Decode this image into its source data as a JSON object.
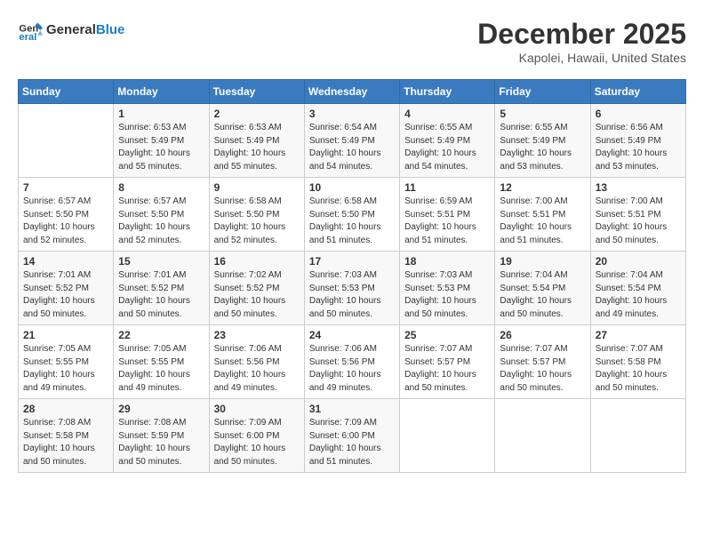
{
  "logo": {
    "line1": "General",
    "line2": "Blue"
  },
  "title": "December 2025",
  "subtitle": "Kapolei, Hawaii, United States",
  "days_header": [
    "Sunday",
    "Monday",
    "Tuesday",
    "Wednesday",
    "Thursday",
    "Friday",
    "Saturday"
  ],
  "weeks": [
    [
      {
        "day": "",
        "info": ""
      },
      {
        "day": "1",
        "info": "Sunrise: 6:53 AM\nSunset: 5:49 PM\nDaylight: 10 hours\nand 55 minutes."
      },
      {
        "day": "2",
        "info": "Sunrise: 6:53 AM\nSunset: 5:49 PM\nDaylight: 10 hours\nand 55 minutes."
      },
      {
        "day": "3",
        "info": "Sunrise: 6:54 AM\nSunset: 5:49 PM\nDaylight: 10 hours\nand 54 minutes."
      },
      {
        "day": "4",
        "info": "Sunrise: 6:55 AM\nSunset: 5:49 PM\nDaylight: 10 hours\nand 54 minutes."
      },
      {
        "day": "5",
        "info": "Sunrise: 6:55 AM\nSunset: 5:49 PM\nDaylight: 10 hours\nand 53 minutes."
      },
      {
        "day": "6",
        "info": "Sunrise: 6:56 AM\nSunset: 5:49 PM\nDaylight: 10 hours\nand 53 minutes."
      }
    ],
    [
      {
        "day": "7",
        "info": "Sunrise: 6:57 AM\nSunset: 5:50 PM\nDaylight: 10 hours\nand 52 minutes."
      },
      {
        "day": "8",
        "info": "Sunrise: 6:57 AM\nSunset: 5:50 PM\nDaylight: 10 hours\nand 52 minutes."
      },
      {
        "day": "9",
        "info": "Sunrise: 6:58 AM\nSunset: 5:50 PM\nDaylight: 10 hours\nand 52 minutes."
      },
      {
        "day": "10",
        "info": "Sunrise: 6:58 AM\nSunset: 5:50 PM\nDaylight: 10 hours\nand 51 minutes."
      },
      {
        "day": "11",
        "info": "Sunrise: 6:59 AM\nSunset: 5:51 PM\nDaylight: 10 hours\nand 51 minutes."
      },
      {
        "day": "12",
        "info": "Sunrise: 7:00 AM\nSunset: 5:51 PM\nDaylight: 10 hours\nand 51 minutes."
      },
      {
        "day": "13",
        "info": "Sunrise: 7:00 AM\nSunset: 5:51 PM\nDaylight: 10 hours\nand 50 minutes."
      }
    ],
    [
      {
        "day": "14",
        "info": "Sunrise: 7:01 AM\nSunset: 5:52 PM\nDaylight: 10 hours\nand 50 minutes."
      },
      {
        "day": "15",
        "info": "Sunrise: 7:01 AM\nSunset: 5:52 PM\nDaylight: 10 hours\nand 50 minutes."
      },
      {
        "day": "16",
        "info": "Sunrise: 7:02 AM\nSunset: 5:52 PM\nDaylight: 10 hours\nand 50 minutes."
      },
      {
        "day": "17",
        "info": "Sunrise: 7:03 AM\nSunset: 5:53 PM\nDaylight: 10 hours\nand 50 minutes."
      },
      {
        "day": "18",
        "info": "Sunrise: 7:03 AM\nSunset: 5:53 PM\nDaylight: 10 hours\nand 50 minutes."
      },
      {
        "day": "19",
        "info": "Sunrise: 7:04 AM\nSunset: 5:54 PM\nDaylight: 10 hours\nand 50 minutes."
      },
      {
        "day": "20",
        "info": "Sunrise: 7:04 AM\nSunset: 5:54 PM\nDaylight: 10 hours\nand 49 minutes."
      }
    ],
    [
      {
        "day": "21",
        "info": "Sunrise: 7:05 AM\nSunset: 5:55 PM\nDaylight: 10 hours\nand 49 minutes."
      },
      {
        "day": "22",
        "info": "Sunrise: 7:05 AM\nSunset: 5:55 PM\nDaylight: 10 hours\nand 49 minutes."
      },
      {
        "day": "23",
        "info": "Sunrise: 7:06 AM\nSunset: 5:56 PM\nDaylight: 10 hours\nand 49 minutes."
      },
      {
        "day": "24",
        "info": "Sunrise: 7:06 AM\nSunset: 5:56 PM\nDaylight: 10 hours\nand 49 minutes."
      },
      {
        "day": "25",
        "info": "Sunrise: 7:07 AM\nSunset: 5:57 PM\nDaylight: 10 hours\nand 50 minutes."
      },
      {
        "day": "26",
        "info": "Sunrise: 7:07 AM\nSunset: 5:57 PM\nDaylight: 10 hours\nand 50 minutes."
      },
      {
        "day": "27",
        "info": "Sunrise: 7:07 AM\nSunset: 5:58 PM\nDaylight: 10 hours\nand 50 minutes."
      }
    ],
    [
      {
        "day": "28",
        "info": "Sunrise: 7:08 AM\nSunset: 5:58 PM\nDaylight: 10 hours\nand 50 minutes."
      },
      {
        "day": "29",
        "info": "Sunrise: 7:08 AM\nSunset: 5:59 PM\nDaylight: 10 hours\nand 50 minutes."
      },
      {
        "day": "30",
        "info": "Sunrise: 7:09 AM\nSunset: 6:00 PM\nDaylight: 10 hours\nand 50 minutes."
      },
      {
        "day": "31",
        "info": "Sunrise: 7:09 AM\nSunset: 6:00 PM\nDaylight: 10 hours\nand 51 minutes."
      },
      {
        "day": "",
        "info": ""
      },
      {
        "day": "",
        "info": ""
      },
      {
        "day": "",
        "info": ""
      }
    ]
  ]
}
